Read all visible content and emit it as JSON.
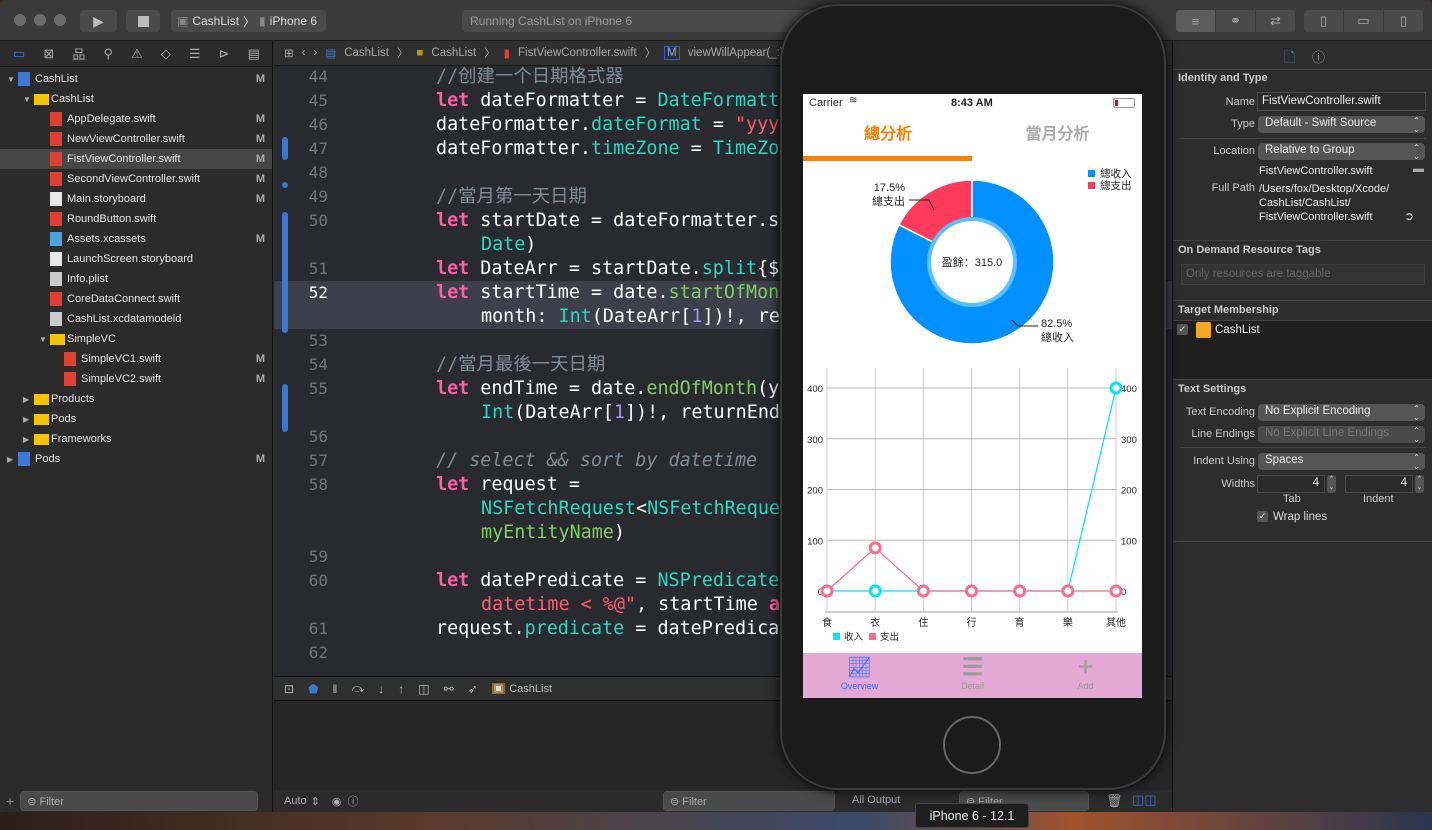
{
  "toolbar": {
    "scheme": "CashList",
    "device": "iPhone 6",
    "activity": "Running CashList on iPhone 6"
  },
  "navigator": {
    "items": [
      {
        "label": "CashList",
        "level": 0,
        "kind": "project",
        "open": true,
        "badge": "M"
      },
      {
        "label": "CashList",
        "level": 1,
        "kind": "folder",
        "open": true,
        "badge": ""
      },
      {
        "label": "AppDelegate.swift",
        "level": 2,
        "kind": "swift",
        "badge": "M"
      },
      {
        "label": "NewViewController.swift",
        "level": 2,
        "kind": "swift",
        "badge": "M"
      },
      {
        "label": "FistViewController.swift",
        "level": 2,
        "kind": "swift",
        "badge": "M",
        "selected": true
      },
      {
        "label": "SecondViewController.swift",
        "level": 2,
        "kind": "swift",
        "badge": "M"
      },
      {
        "label": "Main.storyboard",
        "level": 2,
        "kind": "storyboard",
        "badge": "M"
      },
      {
        "label": "RoundButton.swift",
        "level": 2,
        "kind": "swift",
        "badge": ""
      },
      {
        "label": "Assets.xcassets",
        "level": 2,
        "kind": "assets",
        "badge": "M"
      },
      {
        "label": "LaunchScreen.storyboard",
        "level": 2,
        "kind": "storyboard",
        "badge": ""
      },
      {
        "label": "Info.plist",
        "level": 2,
        "kind": "plist",
        "badge": ""
      },
      {
        "label": "CoreDataConnect.swift",
        "level": 2,
        "kind": "swift",
        "badge": ""
      },
      {
        "label": "CashList.xcdatamodeld",
        "level": 2,
        "kind": "datamodel",
        "badge": ""
      },
      {
        "label": "SimpleVC",
        "level": 2,
        "kind": "folder",
        "open": true,
        "badge": ""
      },
      {
        "label": "SimpleVC1.swift",
        "level": 3,
        "kind": "swift",
        "badge": "M"
      },
      {
        "label": "SimpleVC2.swift",
        "level": 3,
        "kind": "swift",
        "badge": "M"
      },
      {
        "label": "Products",
        "level": 1,
        "kind": "folder",
        "open": false,
        "badge": ""
      },
      {
        "label": "Pods",
        "level": 1,
        "kind": "folder",
        "open": false,
        "badge": ""
      },
      {
        "label": "Frameworks",
        "level": 1,
        "kind": "folder",
        "open": false,
        "badge": ""
      },
      {
        "label": "Pods",
        "level": 0,
        "kind": "project",
        "open": false,
        "badge": "M"
      }
    ],
    "filter_placeholder": "Filter"
  },
  "jumpbar": {
    "crumbs": [
      "CashList",
      "CashList",
      "FistViewController.swift",
      "viewWillAppear(_:)"
    ]
  },
  "editor": {
    "current_line": "52",
    "lines": [
      {
        "n": "44",
        "tokens": [
          {
            "t": "//创建一个日期格式器",
            "c": "comment"
          }
        ]
      },
      {
        "n": "45",
        "tokens": [
          {
            "t": "let",
            "c": "kw"
          },
          {
            "t": " dateFormatter = ",
            "c": "plain"
          },
          {
            "t": "DateFormatt",
            "c": "type"
          }
        ]
      },
      {
        "n": "46",
        "tokens": [
          {
            "t": "dateFormatter.",
            "c": "plain"
          },
          {
            "t": "dateFormat",
            "c": "type"
          },
          {
            "t": " = ",
            "c": "plain"
          },
          {
            "t": "\"yyy",
            "c": "str"
          }
        ]
      },
      {
        "n": "47",
        "tokens": [
          {
            "t": "dateFormatter.",
            "c": "plain"
          },
          {
            "t": "timeZone",
            "c": "type"
          },
          {
            "t": " = ",
            "c": "plain"
          },
          {
            "t": "TimeZo",
            "c": "type"
          }
        ]
      },
      {
        "n": "48",
        "tokens": []
      },
      {
        "n": "49",
        "tokens": [
          {
            "t": "//當月第一天日期",
            "c": "comment"
          }
        ]
      },
      {
        "n": "50",
        "tokens": [
          {
            "t": "let",
            "c": "kw"
          },
          {
            "t": " startDate = dateFormatter.s",
            "c": "plain"
          }
        ]
      },
      {
        "n": "",
        "tokens": [
          {
            "t": "Date",
            "c": "type"
          },
          {
            "t": ")",
            "c": "plain"
          }
        ]
      },
      {
        "n": "51",
        "tokens": [
          {
            "t": "let",
            "c": "kw"
          },
          {
            "t": " DateArr = startDate.",
            "c": "plain"
          },
          {
            "t": "split",
            "c": "type"
          },
          {
            "t": "{$",
            "c": "plain"
          }
        ]
      },
      {
        "n": "52",
        "tokens": [
          {
            "t": "let",
            "c": "kw"
          },
          {
            "t": " startTime = date.",
            "c": "plain"
          },
          {
            "t": "startOfMon",
            "c": "fn"
          }
        ]
      },
      {
        "n": "",
        "tokens": [
          {
            "t": "month: ",
            "c": "plain"
          },
          {
            "t": "Int",
            "c": "type"
          },
          {
            "t": "(DateArr[",
            "c": "plain"
          },
          {
            "t": "1",
            "c": "num"
          },
          {
            "t": "])!, re",
            "c": "plain"
          }
        ]
      },
      {
        "n": "53",
        "tokens": []
      },
      {
        "n": "54",
        "tokens": [
          {
            "t": "//當月最後一天日期",
            "c": "comment"
          }
        ]
      },
      {
        "n": "55",
        "tokens": [
          {
            "t": "let",
            "c": "kw"
          },
          {
            "t": " endTime = date.",
            "c": "plain"
          },
          {
            "t": "endOfMonth",
            "c": "fn"
          },
          {
            "t": "(y",
            "c": "plain"
          }
        ]
      },
      {
        "n": "",
        "tokens": [
          {
            "t": "Int",
            "c": "type"
          },
          {
            "t": "(DateArr[",
            "c": "plain"
          },
          {
            "t": "1",
            "c": "num"
          },
          {
            "t": "])!, returnEnd",
            "c": "plain"
          }
        ]
      },
      {
        "n": "56",
        "tokens": []
      },
      {
        "n": "57",
        "tokens": [
          {
            "t": "// select && sort by datetime",
            "c": "comment it"
          }
        ]
      },
      {
        "n": "58",
        "tokens": [
          {
            "t": "let",
            "c": "kw"
          },
          {
            "t": " request =",
            "c": "plain"
          }
        ]
      },
      {
        "n": "",
        "tokens": [
          {
            "t": "NSFetchRequest",
            "c": "type"
          },
          {
            "t": "<",
            "c": "plain"
          },
          {
            "t": "NSFetchReque",
            "c": "type"
          }
        ]
      },
      {
        "n": "",
        "tokens": [
          {
            "t": "myEntityName",
            "c": "fn"
          },
          {
            "t": ")",
            "c": "plain"
          }
        ]
      },
      {
        "n": "59",
        "tokens": []
      },
      {
        "n": "60",
        "tokens": [
          {
            "t": "let",
            "c": "kw"
          },
          {
            "t": " datePredicate = ",
            "c": "plain"
          },
          {
            "t": "NSPredicate",
            "c": "type"
          }
        ]
      },
      {
        "n": "",
        "tokens": [
          {
            "t": "datetime < %@\"",
            "c": "str"
          },
          {
            "t": ", startTime ",
            "c": "plain"
          },
          {
            "t": "a",
            "c": "kw"
          }
        ]
      },
      {
        "n": "61",
        "tokens": [
          {
            "t": "request.",
            "c": "plain"
          },
          {
            "t": "predicate",
            "c": "type"
          },
          {
            "t": " = datePredica",
            "c": "plain"
          }
        ]
      },
      {
        "n": "62",
        "tokens": []
      }
    ]
  },
  "debug": {
    "target": "CashList",
    "auto_label": "Auto",
    "filter_placeholder": "Filter",
    "output_label": "All Output",
    "filter2_placeholder": "Filter"
  },
  "inspector": {
    "identity_title": "Identity and Type",
    "name_label": "Name",
    "name_value": "FistViewController.swift",
    "type_label": "Type",
    "type_value": "Default - Swift Source",
    "location_label": "Location",
    "location_value": "Relative to Group",
    "location_file": "FistViewController.swift",
    "fullpath_label": "Full Path",
    "fullpath_lines": [
      "/Users/fox/Desktop/Xcode/",
      "CashList/CashList/",
      "FistViewController.swift"
    ],
    "tags_title": "On Demand Resource Tags",
    "tags_placeholder": "Only resources are taggable",
    "membership_title": "Target Membership",
    "membership_target": "CashList",
    "membership_checked": true,
    "text_title": "Text Settings",
    "encoding_label": "Text Encoding",
    "encoding_value": "No Explicit Encoding",
    "endings_label": "Line Endings",
    "endings_value": "No Explicit Line Endings",
    "indent_label": "Indent Using",
    "indent_value": "Spaces",
    "widths_label": "Widths",
    "tab_value": "4",
    "indent_width_value": "4",
    "tab_label": "Tab",
    "indent_width_label": "Indent",
    "wrap_label": "Wrap lines",
    "wrap_checked": true
  },
  "simulator": {
    "carrier": "Carrier",
    "time": "8:43 AM",
    "tabs": [
      {
        "label": "總分析",
        "active": true
      },
      {
        "label": "當月分析",
        "active": false
      }
    ],
    "tabbar": [
      {
        "label": "Overview",
        "active": true,
        "icon": "chart-icon"
      },
      {
        "label": "Detail",
        "active": false,
        "icon": "list-icon"
      },
      {
        "label": "Add",
        "active": false,
        "icon": "plus-icon"
      }
    ],
    "tooltip": "iPhone 6 - 12.1"
  },
  "colors": {
    "accent_orange": "#ff8000",
    "income_blue": "#0090ff",
    "expense_red": "#ff3b5c",
    "line_income": "#00e5ff",
    "line_expense": "#ff6b8b",
    "tabbar_bg": "#e3a8d4",
    "xcode_accent": "#3a78d6"
  },
  "chart_data": [
    {
      "type": "pie",
      "donut": true,
      "center_text": "盈餘：315.0",
      "slices": [
        {
          "name": "總收入",
          "percent": 82.5,
          "label": "82.5%"
        },
        {
          "name": "總支出",
          "percent": 17.5,
          "label": "17.5%"
        }
      ],
      "legend": [
        "總收入",
        "總支出"
      ],
      "legend_position": "top-right"
    },
    {
      "type": "line",
      "categories": [
        "食",
        "衣",
        "住",
        "行",
        "育",
        "樂",
        "其他"
      ],
      "series": [
        {
          "name": "收入",
          "values": [
            0,
            0,
            0,
            0,
            0,
            0,
            400
          ]
        },
        {
          "name": "支出",
          "values": [
            0,
            85,
            0,
            0,
            0,
            0,
            0
          ]
        }
      ],
      "ylim": [
        0,
        400
      ],
      "yticks": [
        0,
        100,
        200,
        300,
        400
      ],
      "right_axis": true,
      "grid": true,
      "legend_position": "bottom-left"
    }
  ]
}
